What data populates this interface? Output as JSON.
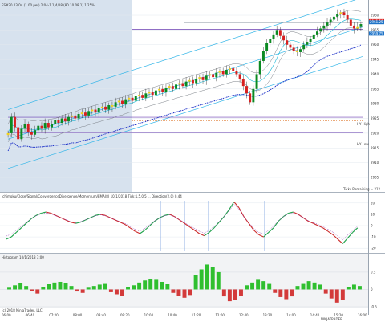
{
  "header": {
    "instrument_text": "ES#20 03/04 (1.00 per) 2:04-1 1/4/18 (80.10.08.1) 1.25%",
    "price_label": "2960.00"
  },
  "colors": {
    "bg": "#ffffff",
    "shade": "#d7e2ee",
    "grid": "#e3e8ef",
    "up": "#0b8a22",
    "down": "#d81f1f",
    "doji": "#f2d21b",
    "channel": "#34b6e8",
    "ma_blue": "#1f33c8",
    "ma_band": "#7a7f86",
    "purple_line": "#6b3fb2",
    "orange_line": "#e07a2e",
    "osc_green": "#1fa24b",
    "osc_red": "#cc2b2b",
    "osc_purple": "#8e2fb0",
    "hist_pos": "#2fbf2f",
    "hist_neg": "#d33a3a",
    "hist_bg": "#f2f3f5"
  },
  "chart_data": [
    {
      "type": "candlestick",
      "panel": "price",
      "xlabel": "",
      "ylabel": "",
      "y_ticks": [
        "2960",
        "2955",
        "2950",
        "2945",
        "2940",
        "2935",
        "2930",
        "2925",
        "2920",
        "2915",
        "2910",
        "2905"
      ],
      "x_ticks": [
        "06:00",
        "06:40",
        "07:20",
        "08:00",
        "08:40",
        "09:20",
        "10:00",
        "10:40",
        "11:20",
        "12:00",
        "12:40",
        "13:20",
        "14:00",
        "14:40",
        "15:20",
        "16:00"
      ],
      "price_labels": [
        {
          "text": "2963.50",
          "color": "#d81f1f"
        },
        {
          "text": "2961.25",
          "color": "#1f74c8"
        },
        {
          "text": "2959.75",
          "color": "#1f74c8"
        }
      ],
      "annotations": [
        "HY High",
        "HY Low"
      ],
      "footer_left": "Ticks Remaining = 212",
      "close_series": [
        2920.0,
        2925.5,
        2922.0,
        2918.0,
        2921.5,
        2923.0,
        2920.5,
        2919.5,
        2921.0,
        2922.5,
        2921.5,
        2923.5,
        2922.0,
        2923.0,
        2924.5,
        2923.5,
        2925.0,
        2924.0,
        2925.5,
        2926.0,
        2925.0,
        2926.5,
        2927.0,
        2926.0,
        2927.5,
        2928.0,
        2927.0,
        2928.5,
        2929.0,
        2928.0,
        2929.5,
        2929.0,
        2930.5,
        2931.0,
        2930.0,
        2931.5,
        2932.0,
        2931.0,
        2932.5,
        2933.0,
        2932.0,
        2933.5,
        2934.0,
        2933.0,
        2934.5,
        2935.0,
        2934.0,
        2935.5,
        2936.0,
        2935.0,
        2936.5,
        2937.0,
        2936.0,
        2937.5,
        2938.0,
        2937.0,
        2938.5,
        2939.0,
        2938.0,
        2939.5,
        2940.0,
        2939.0,
        2940.5,
        2941.0,
        2940.0,
        2941.5,
        2942.0,
        2941.0,
        2940.0,
        2938.5,
        2936.0,
        2933.5,
        2930.5,
        2935.0,
        2940.0,
        2944.5,
        2948.0,
        2950.5,
        2952.0,
        2953.5,
        2955.0,
        2953.0,
        2951.5,
        2950.0,
        2949.0,
        2948.0,
        2947.5,
        2948.5,
        2950.0,
        2951.0,
        2952.0,
        2953.5,
        2954.5,
        2955.5,
        2956.5,
        2957.5,
        2958.5,
        2959.5,
        2960.5,
        2961.0,
        2960.0,
        2958.5,
        2956.5,
        2955.5,
        2956.0,
        2957.0
      ]
    },
    {
      "type": "line",
      "panel": "oscillator",
      "title": "Ichimoku/Close/Signal/ConvergenceDivergence/Momentum/EMA(8) 10/1/2018 Tick:1,5,0.5 ... Direction(2.0) 0.44",
      "y_ticks": [
        "20",
        "10",
        "0",
        "-10",
        "-20"
      ],
      "series": [
        {
          "values": [
            -12,
            -10,
            -6,
            -2,
            2,
            6,
            9,
            11,
            12,
            11,
            9,
            7,
            5,
            3,
            2,
            3,
            5,
            7,
            9,
            10,
            9,
            7,
            5,
            3,
            1,
            -2,
            -5,
            -7,
            -4,
            0,
            4,
            7,
            9,
            10,
            8,
            5,
            2,
            -1,
            -4,
            -7,
            -9,
            -6,
            -2,
            3,
            8,
            14,
            21,
            16,
            8,
            2,
            -4,
            -8,
            -10,
            -6,
            -2,
            4,
            8,
            11,
            12,
            10,
            7,
            4,
            2,
            0,
            -2,
            -5,
            -8,
            -12,
            -16,
            -11,
            -6,
            -2
          ]
        }
      ]
    },
    {
      "type": "bar",
      "panel": "histogram",
      "title": "Histogram 10/1/2018 3:00",
      "y_ticks": [
        "0.5",
        "0",
        "-0.5"
      ],
      "values": [
        0.05,
        0.12,
        0.18,
        0.1,
        -0.05,
        -0.12,
        0.08,
        0.15,
        0.2,
        0.22,
        0.18,
        0.1,
        -0.06,
        -0.1,
        0.05,
        0.1,
        0.14,
        0.16,
        -0.08,
        -0.14,
        -0.18,
        0.06,
        0.12,
        0.2,
        0.26,
        0.3,
        0.28,
        0.22,
        0.15,
        -0.1,
        -0.18,
        -0.24,
        -0.16,
        0.42,
        0.58,
        0.72,
        0.66,
        0.5,
        -0.2,
        -0.34,
        -0.3,
        -0.18,
        0.12,
        0.2,
        0.28,
        0.24,
        0.16,
        -0.1,
        -0.22,
        -0.28,
        -0.2,
        0.1,
        0.16,
        0.24,
        0.2,
        0.14,
        -0.12,
        -0.26,
        -0.38,
        -0.3,
        0.08,
        0.14,
        0.1
      ]
    }
  ],
  "bottom_note": "(c) 2018 NinjaTrader, LLC",
  "watermark": "NINJATRADER"
}
